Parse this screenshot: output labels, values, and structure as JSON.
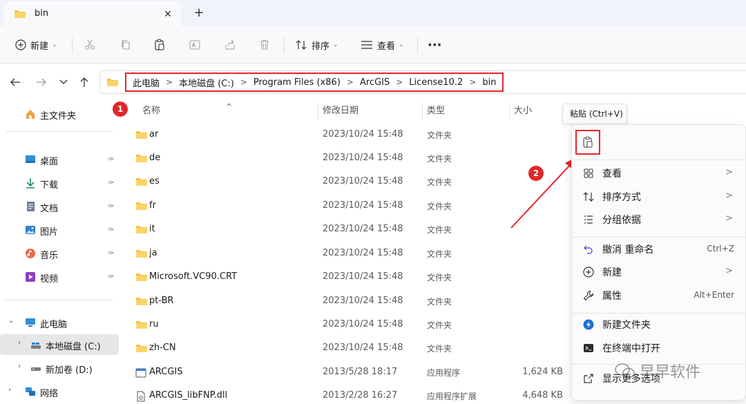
{
  "tab": {
    "title": "bin",
    "close": "✕",
    "new": "+"
  },
  "toolbar": {
    "new_label": "新建",
    "sort_label": "排序",
    "view_label": "查看",
    "more": "···"
  },
  "breadcrumb": [
    "此电脑",
    "本地磁盘 (C:)",
    "Program Files (x86)",
    "ArcGIS",
    "License10.2",
    "bin"
  ],
  "breadcrumb_separator": ">",
  "sidebar": {
    "home": "主文件夹",
    "quick": [
      {
        "label": "桌面",
        "icon": "desktop-icon"
      },
      {
        "label": "下载",
        "icon": "download-icon"
      },
      {
        "label": "文档",
        "icon": "document-icon"
      },
      {
        "label": "图片",
        "icon": "pictures-icon"
      },
      {
        "label": "音乐",
        "icon": "music-icon"
      },
      {
        "label": "视频",
        "icon": "video-icon"
      }
    ],
    "pin": "📌",
    "this_pc": "此电脑",
    "drive_c": "本地磁盘 (C:)",
    "drive_d": "新加卷 (D:)",
    "network": "网络"
  },
  "columns": {
    "name": "名称",
    "date": "修改日期",
    "type": "类型",
    "size": "大小"
  },
  "files": [
    {
      "name": "ar",
      "date": "2023/10/24 15:48",
      "type": "文件夹",
      "size": "",
      "kind": "folder"
    },
    {
      "name": "de",
      "date": "2023/10/24 15:48",
      "type": "文件夹",
      "size": "",
      "kind": "folder"
    },
    {
      "name": "es",
      "date": "2023/10/24 15:48",
      "type": "文件夹",
      "size": "",
      "kind": "folder"
    },
    {
      "name": "fr",
      "date": "2023/10/24 15:48",
      "type": "文件夹",
      "size": "",
      "kind": "folder"
    },
    {
      "name": "it",
      "date": "2023/10/24 15:48",
      "type": "文件夹",
      "size": "",
      "kind": "folder"
    },
    {
      "name": "ja",
      "date": "2023/10/24 15:48",
      "type": "文件夹",
      "size": "",
      "kind": "folder"
    },
    {
      "name": "Microsoft.VC90.CRT",
      "date": "2023/10/24 15:48",
      "type": "文件夹",
      "size": "",
      "kind": "folder"
    },
    {
      "name": "pt-BR",
      "date": "2023/10/24 15:48",
      "type": "文件夹",
      "size": "",
      "kind": "folder"
    },
    {
      "name": "ru",
      "date": "2023/10/24 15:48",
      "type": "文件夹",
      "size": "",
      "kind": "folder"
    },
    {
      "name": "zh-CN",
      "date": "2023/10/24 15:48",
      "type": "文件夹",
      "size": "",
      "kind": "folder"
    },
    {
      "name": "ARCGIS",
      "date": "2013/5/28 18:17",
      "type": "应用程序",
      "size": "1,624 KB",
      "kind": "exe"
    },
    {
      "name": "ARCGIS_libFNP.dll",
      "date": "2013/2/28 16:27",
      "type": "应用程序扩展",
      "size": "4,648 KB",
      "kind": "dll"
    }
  ],
  "annotations": {
    "badge1": "1",
    "badge2": "2"
  },
  "tooltip": "粘贴 (Ctrl+V)",
  "context_menu": {
    "items": [
      {
        "label": "查看",
        "icon": "grid-icon",
        "submenu": true,
        "shortcut": ""
      },
      {
        "label": "排序方式",
        "icon": "sort-icon",
        "submenu": true,
        "shortcut": ""
      },
      {
        "label": "分组依据",
        "icon": "group-icon",
        "submenu": true,
        "shortcut": ""
      },
      {
        "label": "撤消 重命名",
        "icon": "undo-icon",
        "submenu": false,
        "shortcut": "Ctrl+Z"
      },
      {
        "label": "新建",
        "icon": "plus-circle-icon",
        "submenu": true,
        "shortcut": ""
      },
      {
        "label": "属性",
        "icon": "wrench-icon",
        "submenu": false,
        "shortcut": "Alt+Enter"
      },
      {
        "label": "新建文件夹",
        "icon": "new-folder-icon",
        "submenu": false,
        "shortcut": ""
      },
      {
        "label": "在终端中打开",
        "icon": "terminal-icon",
        "submenu": false,
        "shortcut": ""
      },
      {
        "label": "显示更多选项",
        "icon": "more-options-icon",
        "submenu": false,
        "shortcut": ""
      }
    ],
    "arrow": ">"
  },
  "watermark": "早早软件",
  "colors": {
    "accent_red": "#e5252a",
    "folder_yellow": "#f5c344",
    "background": "#ffffff"
  }
}
